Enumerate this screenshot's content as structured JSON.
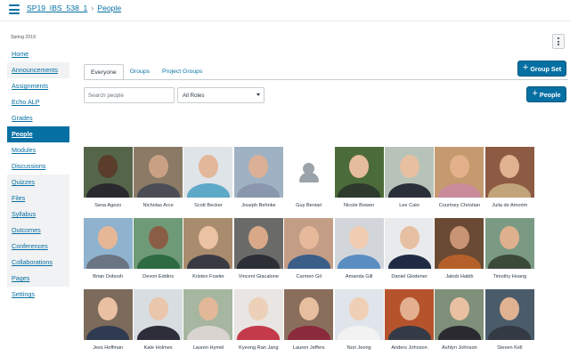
{
  "breadcrumb": {
    "course": "SP19_IBS_538_1",
    "page": "People"
  },
  "term": "Spring 2019",
  "nav": [
    {
      "label": "Home",
      "name": "home",
      "shaded": false
    },
    {
      "label": "Announcements",
      "name": "announcements",
      "shaded": true
    },
    {
      "label": "Assignments",
      "name": "assignments",
      "shaded": false
    },
    {
      "label": "Echo ALP",
      "name": "echo-alp",
      "shaded": false
    },
    {
      "label": "Grades",
      "name": "grades",
      "shaded": false
    },
    {
      "label": "People",
      "name": "people",
      "shaded": false,
      "active": true
    },
    {
      "label": "Modules",
      "name": "modules",
      "shaded": false
    },
    {
      "label": "Discussions",
      "name": "discussions",
      "shaded": false
    },
    {
      "label": "Quizzes",
      "name": "quizzes",
      "shaded": true
    },
    {
      "label": "Files",
      "name": "files",
      "shaded": true
    },
    {
      "label": "Syllabus",
      "name": "syllabus",
      "shaded": true
    },
    {
      "label": "Outcomes",
      "name": "outcomes",
      "shaded": true
    },
    {
      "label": "Conferences",
      "name": "conferences",
      "shaded": true
    },
    {
      "label": "Collaborations",
      "name": "collaborations",
      "shaded": true
    },
    {
      "label": "Pages",
      "name": "pages",
      "shaded": true
    },
    {
      "label": "Settings",
      "name": "settings",
      "shaded": false
    }
  ],
  "tabs": [
    {
      "label": "Everyone",
      "active": true
    },
    {
      "label": "Groups",
      "active": false
    },
    {
      "label": "Project Groups",
      "active": false
    }
  ],
  "buttons": {
    "group_set": "Group Set",
    "people": "People"
  },
  "search": {
    "placeholder": "Search people",
    "value": ""
  },
  "roles_select": {
    "value": "All Roles"
  },
  "people": [
    {
      "name": "Sena Agezo",
      "bg": "#55654a",
      "skin": "#5a3d2b",
      "shirt": "#2a2a2e"
    },
    {
      "name": "Nicholas Arce",
      "bg": "#8a7a66",
      "skin": "#c9a084",
      "shirt": "#4a4d55"
    },
    {
      "name": "Scott Becker",
      "bg": "#dfe4e8",
      "skin": "#e2b79a",
      "shirt": "#5ea8c8"
    },
    {
      "name": "Joseph Behnke",
      "bg": "#9fb2c4",
      "skin": "#dcb096",
      "shirt": "#8a97ad"
    },
    {
      "name": "Guy Beniari",
      "placeholder": true
    },
    {
      "name": "Nicole Bowen",
      "bg": "#4c6b3a",
      "skin": "#e5bc9c",
      "shirt": "#2d3a2c"
    },
    {
      "name": "Lee Cato",
      "bg": "#b7c3b9",
      "skin": "#e7c0a2",
      "shirt": "#2a2f3a"
    },
    {
      "name": "Courtney Christian",
      "bg": "#c59a6e",
      "skin": "#e2b08a",
      "shirt": "#c98a9a"
    },
    {
      "name": "Julia de Amorim",
      "bg": "#8d5a43",
      "skin": "#e0b290",
      "shirt": "#c1a47a"
    },
    {
      "name": "Brian Dobosh",
      "bg": "#8fb3cf",
      "skin": "#e6b797",
      "shirt": "#6a7483"
    },
    {
      "name": "Devon Eddins",
      "bg": "#6f9a77",
      "skin": "#8a5e45",
      "shirt": "#2e6a42"
    },
    {
      "name": "Kristen Fowler",
      "bg": "#a98c6e",
      "skin": "#ebc2a2",
      "shirt": "#3a3a44"
    },
    {
      "name": "Vincent Giacalone",
      "bg": "#6a6b69",
      "skin": "#d8a888",
      "shirt": "#2c2f35"
    },
    {
      "name": "Carmen Gil",
      "bg": "#c39d86",
      "skin": "#e6b99b",
      "shirt": "#3a5e88"
    },
    {
      "name": "Amanda Gill",
      "bg": "#d2d6db",
      "skin": "#f0ccb2",
      "shirt": "#5a8ec2"
    },
    {
      "name": "Daniel Glodener",
      "bg": "#e9eaec",
      "skin": "#e7bfa2",
      "shirt": "#1f2b44"
    },
    {
      "name": "Jakob Habib",
      "bg": "#6b4a33",
      "skin": "#c99476",
      "shirt": "#b5602a"
    },
    {
      "name": "Timothy Hoang",
      "bg": "#7a9a84",
      "skin": "#dfb08e",
      "shirt": "#3c4a3a"
    },
    {
      "name": "Jess Hoffman",
      "bg": "#7c6a5b",
      "skin": "#e9c0a2",
      "shirt": "#2e3b50"
    },
    {
      "name": "Kate Holmes",
      "bg": "#d8dde2",
      "skin": "#eac6ac",
      "shirt": "#2e2e3a"
    },
    {
      "name": "Lauren Hymel",
      "bg": "#a6b6a0",
      "skin": "#e2b898",
      "shirt": "#d9d4cf"
    },
    {
      "name": "Kyeong Ran Jang",
      "bg": "#e8e5e2",
      "skin": "#edd0b8",
      "shirt": "#c43a4a"
    },
    {
      "name": "Lauren Jeffers",
      "bg": "#8a6e5c",
      "skin": "#e7bf9f",
      "shirt": "#8a2a3a"
    },
    {
      "name": "Nuri Jeong",
      "bg": "#dfe5ea",
      "skin": "#efd0b6",
      "shirt": "#f2f2f2"
    },
    {
      "name": "Anders Johnson",
      "bg": "#b5532c",
      "skin": "#e2b090",
      "shirt": "#343a46"
    },
    {
      "name": "Ashlyn Johnson",
      "bg": "#7f8f7a",
      "skin": "#e9c1a2",
      "shirt": "#2a2a30"
    },
    {
      "name": "Steven Kell",
      "bg": "#4a5b6a",
      "skin": "#e0b292",
      "shirt": "#333a44"
    }
  ]
}
